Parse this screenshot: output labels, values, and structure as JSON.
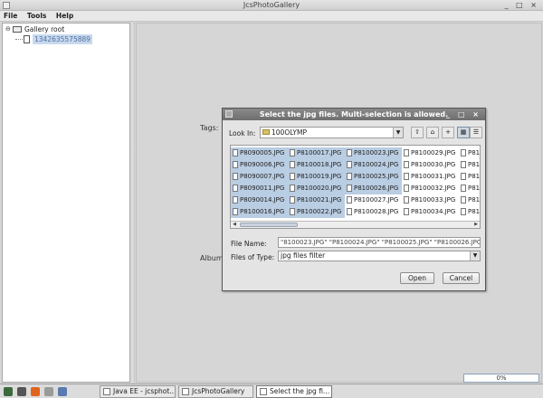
{
  "window": {
    "title": "JcsPhotoGallery",
    "controls": "_ □ ×"
  },
  "menu": [
    "File",
    "Tools",
    "Help"
  ],
  "tree": {
    "root_expander": "⊖",
    "root_label": "Gallery root",
    "child_label": "1342635575889"
  },
  "main": {
    "tags_label": "Tags:",
    "album_label": "Album"
  },
  "dialog": {
    "title": "Select the jpg files. Multi-selection is allowed.",
    "controls": "_ □ ×",
    "look_in_label": "Look In:",
    "look_in_value": "100OLYMP",
    "combo_arrow": "▼",
    "toolbar_icons": [
      "folder-up-icon",
      "home-icon",
      "new-folder-icon",
      "list-view-icon",
      "details-view-icon"
    ],
    "toolbar_glyphs": [
      "⇧",
      "⌂",
      "+",
      "▦",
      "☰"
    ],
    "columns": [
      {
        "files": [
          "P8090005.JPG",
          "P8090006.JPG",
          "P8090007.JPG",
          "P8090011.JPG",
          "P8090014.JPG",
          "P8100016.JPG"
        ],
        "selected": [
          true,
          true,
          true,
          true,
          true,
          true
        ]
      },
      {
        "files": [
          "P8100017.JPG",
          "P8100018.JPG",
          "P8100019.JPG",
          "P8100020.JPG",
          "P8100021.JPG",
          "P8100022.JPG"
        ],
        "selected": [
          true,
          true,
          true,
          true,
          true,
          true
        ]
      },
      {
        "files": [
          "P8100023.JPG",
          "P8100024.JPG",
          "P8100025.JPG",
          "P8100026.JPG",
          "P8100027.JPG",
          "P8100028.JPG"
        ],
        "selected": [
          true,
          true,
          true,
          true,
          false,
          false
        ]
      },
      {
        "files": [
          "P8100029.JPG",
          "P8100030.JPG",
          "P8100031.JPG",
          "P8100032.JPG",
          "P8100033.JPG",
          "P8100034.JPG"
        ],
        "selected": [
          false,
          false,
          false,
          false,
          false,
          false
        ]
      },
      {
        "files": [
          "P81",
          "P81",
          "P81",
          "P81",
          "P81",
          "P81"
        ],
        "selected": [
          false,
          false,
          false,
          false,
          false,
          false
        ]
      }
    ],
    "scroll_left": "◀",
    "scroll_right": "▶",
    "file_name_label": "File Name:",
    "file_name_value": "\"8100023.JPG\" \"P8100024.JPG\" \"P8100025.JPG\" \"P8100026.JPG\"",
    "files_of_type_label": "Files of Type:",
    "files_of_type_value": "jpg files filter",
    "open_button": "Open",
    "cancel_button": "Cancel"
  },
  "status": {
    "progress_text": "0%",
    "progress_value": 0
  },
  "taskbar": {
    "launchers": [
      {
        "name": "menu-launcher-icon",
        "color": "#3c6a3c"
      },
      {
        "name": "terminal-launcher-icon",
        "color": "#555555"
      },
      {
        "name": "firefox-launcher-icon",
        "color": "#e0641e"
      },
      {
        "name": "files-launcher-icon",
        "color": "#9a9a9a"
      },
      {
        "name": "desktop-launcher-icon",
        "color": "#5a7bb0"
      }
    ],
    "tasks": [
      "Java EE - jcsphot...",
      "JcsPhotoGallery",
      "Select the jpg fi..."
    ]
  }
}
